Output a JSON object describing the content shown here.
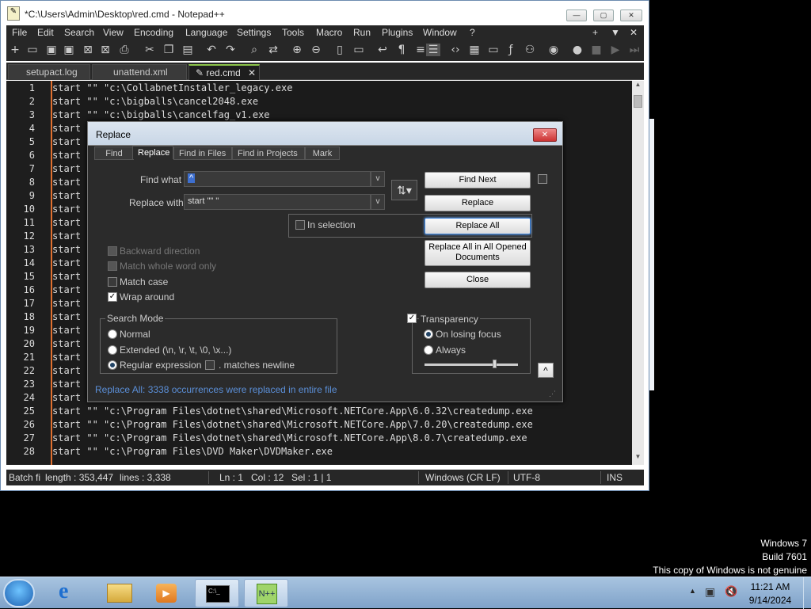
{
  "window": {
    "title": "*C:\\Users\\Admin\\Desktop\\red.cmd - Notepad++"
  },
  "menu": [
    "File",
    "Edit",
    "Search",
    "View",
    "Encoding",
    "Language",
    "Settings",
    "Tools",
    "Macro",
    "Run",
    "Plugins",
    "Window",
    "?"
  ],
  "menu_right": [
    "+",
    "▼",
    "✕"
  ],
  "tabs": [
    {
      "label": "setupact.log"
    },
    {
      "label": "unattend.xml"
    },
    {
      "label": "red.cmd",
      "active": true
    }
  ],
  "editor": {
    "lines_top": [
      {
        "n": "1",
        "text": "start \"\" \"c:\\CollabnetInstaller_legacy.exe"
      },
      {
        "n": "2",
        "text": "start \"\" \"c:\\bigballs\\cancel2048.exe"
      },
      {
        "n": "3",
        "text": "start \"\" \"c:\\bigballs\\cancelfag_v1.exe"
      }
    ],
    "hidden_lines": [
      "4",
      "5",
      "6",
      "7",
      "8",
      "9",
      "10",
      "11",
      "12",
      "13",
      "14",
      "15",
      "16",
      "17",
      "18",
      "19",
      "20",
      "21",
      "22",
      "23",
      "24"
    ],
    "lines_bottom": [
      {
        "n": "25",
        "text": "start \"\" \"c:\\Program Files\\dotnet\\shared\\Microsoft.NETCore.App\\6.0.32\\createdump.exe"
      },
      {
        "n": "26",
        "text": "start \"\" \"c:\\Program Files\\dotnet\\shared\\Microsoft.NETCore.App\\7.0.20\\createdump.exe"
      },
      {
        "n": "27",
        "text": "start \"\" \"c:\\Program Files\\dotnet\\shared\\Microsoft.NETCore.App\\8.0.7\\createdump.exe"
      },
      {
        "n": "28",
        "text": "start \"\" \"c:\\Program Files\\DVD Maker\\DVDMaker.exe"
      }
    ],
    "prefix": "start"
  },
  "status": {
    "type": "Batch fi",
    "length": "length : 353,447",
    "lines": "lines : 3,338",
    "ln": "Ln : 1",
    "col": "Col : 12",
    "sel": "Sel : 1 | 1",
    "eol": "Windows (CR LF)",
    "encoding": "UTF-8",
    "mode": "INS"
  },
  "dialog": {
    "title": "Replace",
    "tabs": [
      "Find",
      "Replace",
      "Find in Files",
      "Find in Projects",
      "Mark"
    ],
    "find_label": "Find what :",
    "find_value": "^",
    "replace_label": "Replace with :",
    "replace_value": "start \"\" \"",
    "buttons": {
      "find_next": "Find Next",
      "replace": "Replace",
      "replace_all": "Replace All",
      "replace_all_opened": "Replace All in All Opened Documents",
      "close": "Close"
    },
    "in_selection": "In selection",
    "options": {
      "backward": "Backward direction",
      "whole_word": "Match whole word only",
      "match_case": "Match case",
      "wrap": "Wrap around"
    },
    "search_mode": {
      "title": "Search Mode",
      "normal": "Normal",
      "extended": "Extended (\\n, \\r, \\t, \\0, \\x...)",
      "regex": "Regular expression",
      "newline": ". matches newline"
    },
    "transparency": {
      "title": "Transparency",
      "on_losing": "On losing focus",
      "always": "Always",
      "slider_level": 0.75
    },
    "status": "Replace All: 3338 occurrences were replaced in entire file",
    "colors": {
      "status": "#5b8fd8"
    }
  },
  "watermark": {
    "l1": "Windows 7",
    "l2": "Build 7601",
    "l3": "This copy of Windows is not genuine"
  },
  "tray": {
    "time": "11:21 AM",
    "date": "9/14/2024"
  }
}
